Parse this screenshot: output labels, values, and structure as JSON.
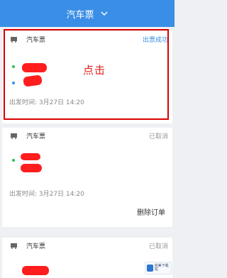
{
  "header": {
    "title": "汽车票"
  },
  "orders": [
    {
      "type": "汽车票",
      "status": "出票成功",
      "depart": "出发时间: 3月27日 14:20"
    },
    {
      "type": "汽车票",
      "status": "已取消",
      "depart": "出发时间: 3月27日 14:20",
      "action": "删除订单"
    },
    {
      "type": "汽车票",
      "status": "已取消"
    }
  ],
  "annotation": "点击",
  "watermark": "完美下载站",
  "colors": {
    "header": "#3a8ee6",
    "highlight": "#d90000",
    "redact": "#ff1d1d",
    "green_dot": "#2bbf5a",
    "blue_dot": "#3a8ee6"
  }
}
